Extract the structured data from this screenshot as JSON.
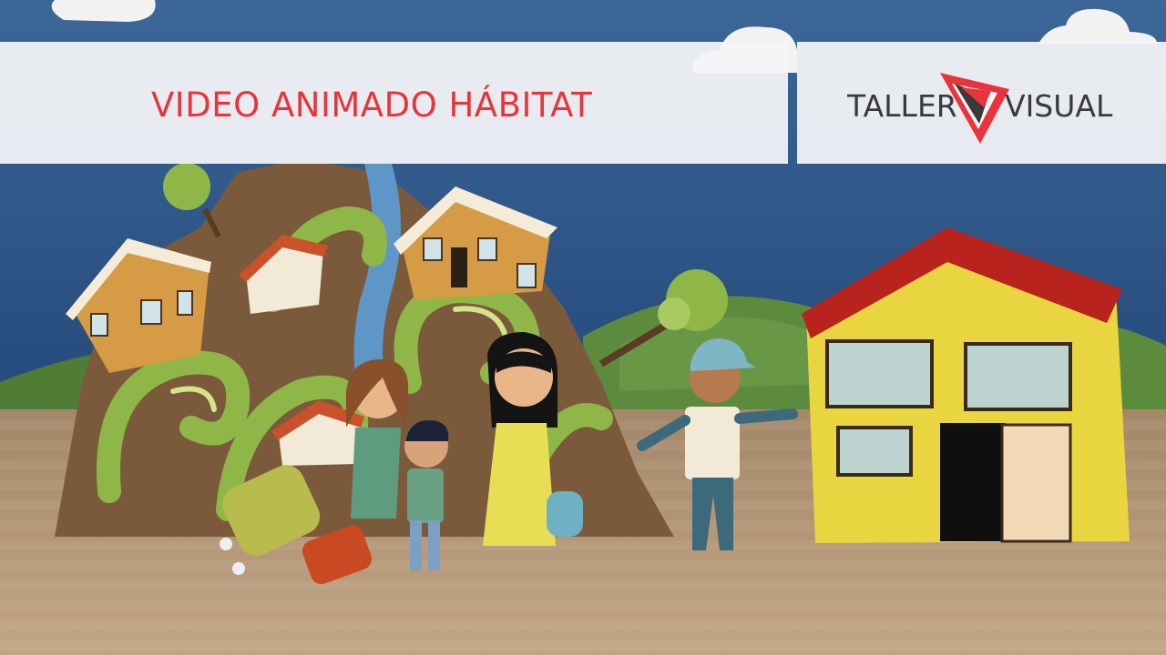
{
  "banner": {
    "title": "VIDEO ANIMADO HÁBITAT"
  },
  "logo": {
    "left_word": "TALLER",
    "right_word": "VISUAL",
    "accent_color": "#e8343b",
    "text_color": "#3a3a3a"
  },
  "colors": {
    "sky": "#2f5a8c",
    "ground": "#b89a7a",
    "house_yellow": "#e9d53f",
    "roof_red": "#b8231d",
    "hills_green": "#5d8b3e"
  }
}
